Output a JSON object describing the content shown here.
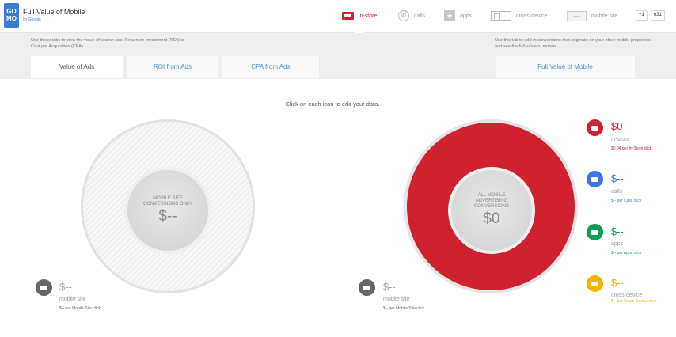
{
  "header": {
    "logo_text": "GO MO",
    "title": "Full Value of Mobile",
    "subtitle_prefix": "by",
    "subtitle_brand": "Google",
    "nav": [
      {
        "label": "in-store",
        "icon": "store-icon"
      },
      {
        "label": "calls",
        "icon": "phone-icon"
      },
      {
        "label": "apps",
        "icon": "star-icon"
      },
      {
        "label": "cross-device",
        "icon": "devices-icon"
      },
      {
        "label": "mobile site",
        "icon": "www-icon",
        "icon_text": "www"
      }
    ],
    "gplus_label": "+1",
    "gplus_count": "631"
  },
  "band": {
    "left_note": "Use these tabs to view the value of search ads, Return on Investment (ROI) or Cost per Acquisition (CPA).",
    "right_note": "Use this tab to add in conversions that originate on your other mobile properties, and see the full value of mobile.",
    "tabs": [
      {
        "label": "Value of Ads",
        "active": true
      },
      {
        "label": "ROI from Ads",
        "active": false
      },
      {
        "label": "CPA from Ads",
        "active": false
      },
      {
        "label": "Full Value of Mobile",
        "active": false
      }
    ]
  },
  "main": {
    "instruction": "Click on each icon to edit your data.",
    "left_chart": {
      "label": "MOBILE SITE CONVERSIONS ONLY",
      "value": "$--"
    },
    "right_chart": {
      "label": "ALL MOBILE ADVERTISING CONVERSIONS",
      "value": "$0",
      "fill_color": "#d0212e"
    },
    "left_stat": {
      "value": "$--",
      "name": "mobile site",
      "per": "$-- per Mobile Site click"
    },
    "right_stats": [
      {
        "value": "$0",
        "name": "in-store",
        "per": "$0.04 per In-Store click",
        "color": "#d0212e",
        "icon": "store-icon"
      },
      {
        "value": "$--",
        "name": "calls",
        "per": "$-- per Calls click",
        "color": "#3b78e7",
        "icon": "phone-icon"
      },
      {
        "value": "$--",
        "name": "apps",
        "per": "$-- per Apps click",
        "color": "#0f9d58",
        "icon": "app-icon"
      },
      {
        "value": "$--",
        "name": "cross-device",
        "per": "$-- per Cross-Device click",
        "color": "#f4b400",
        "icon": "devices-icon"
      }
    ],
    "mobile_stat": {
      "value": "$--",
      "name": "mobile site",
      "per": "$-- per Mobile Site click",
      "color": "#666666"
    }
  }
}
